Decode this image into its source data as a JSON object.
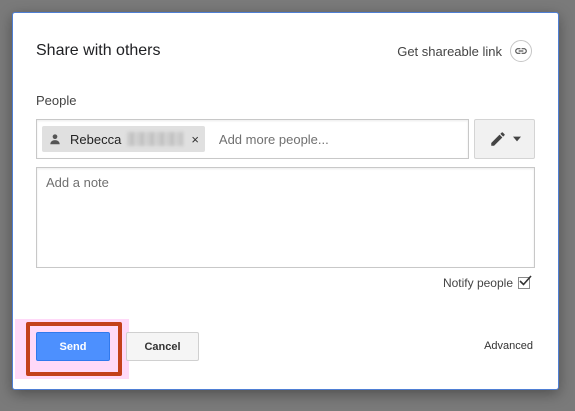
{
  "dialog": {
    "title": "Share with others",
    "share_link_label": "Get shareable link",
    "people_label": "People",
    "recipients": [
      {
        "name": "Rebecca",
        "remove_label": "×"
      }
    ],
    "add_people_placeholder": "Add more people...",
    "note_placeholder": "Add a note",
    "notify_label": "Notify people",
    "notify_checked": true,
    "send_label": "Send",
    "cancel_label": "Cancel",
    "advanced_label": "Advanced"
  },
  "icons": {
    "share_link": "link-icon",
    "recipient": "person-icon",
    "permission": "pencil-icon",
    "dropdown": "caret-down-icon",
    "notify": "checkmark-icon"
  },
  "colors": {
    "primary_button": "#4d90fe",
    "highlight_frame": "#c4401a",
    "highlight_fill": "#ffaaf0"
  }
}
